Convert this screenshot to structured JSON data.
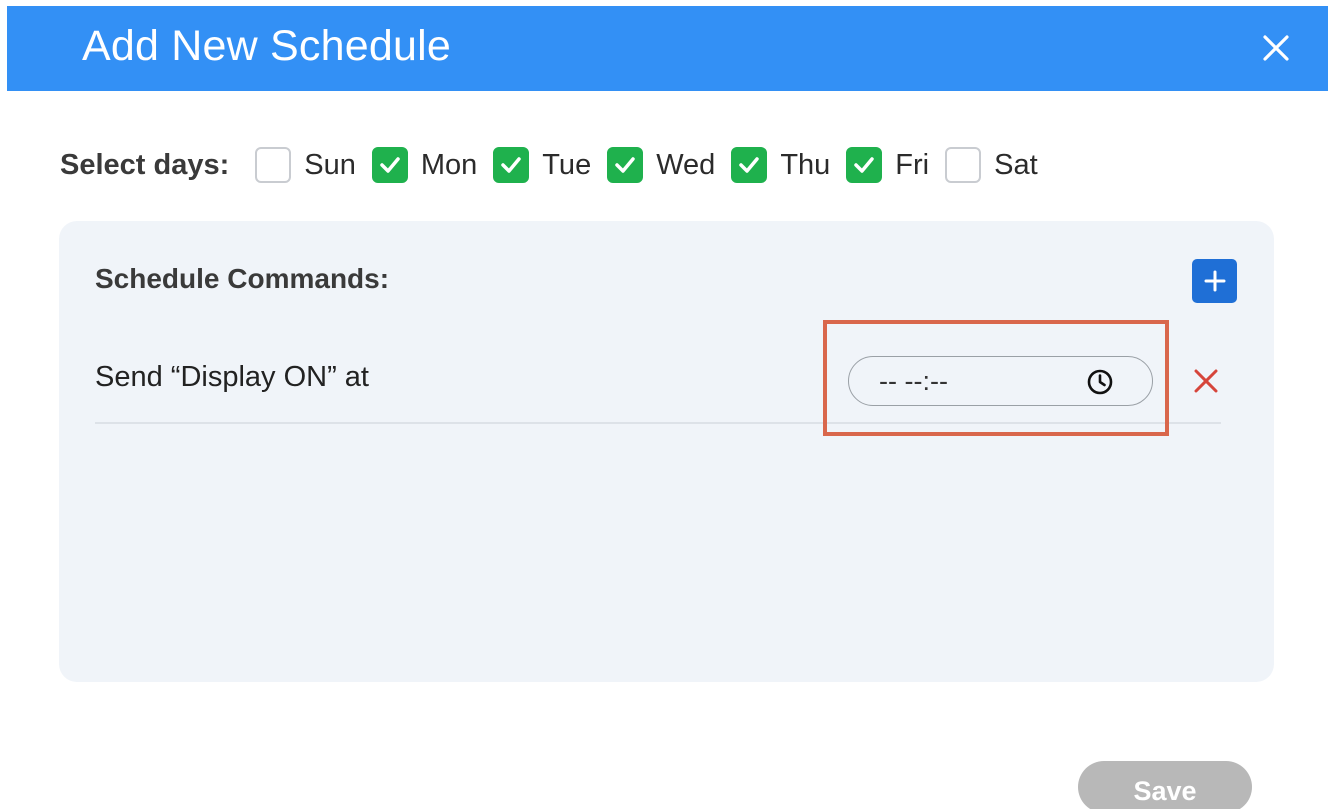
{
  "header": {
    "title": "Add New Schedule",
    "close_icon": "close-icon"
  },
  "days": {
    "label": "Select days:",
    "items": [
      {
        "label": "Sun",
        "checked": false
      },
      {
        "label": "Mon",
        "checked": true
      },
      {
        "label": "Tue",
        "checked": true
      },
      {
        "label": "Wed",
        "checked": true
      },
      {
        "label": "Thu",
        "checked": true
      },
      {
        "label": "Fri",
        "checked": true
      },
      {
        "label": "Sat",
        "checked": false
      }
    ]
  },
  "commands": {
    "title": "Schedule Commands:",
    "add_icon": "plus-icon",
    "rows": [
      {
        "text": "Send “Display ON” at",
        "time_value": "-- --:--",
        "time_icon": "clock-icon",
        "delete_icon": "x-icon"
      }
    ]
  },
  "footer": {
    "save_label": "Save"
  },
  "colors": {
    "header_bg": "#3390f5",
    "checkbox_checked": "#1fb14d",
    "add_button": "#1f6fd6",
    "delete_icon": "#d6453b",
    "highlight": "#d9674c",
    "save_disabled": "#b8b8b8",
    "panel_bg": "#f0f4f9"
  }
}
